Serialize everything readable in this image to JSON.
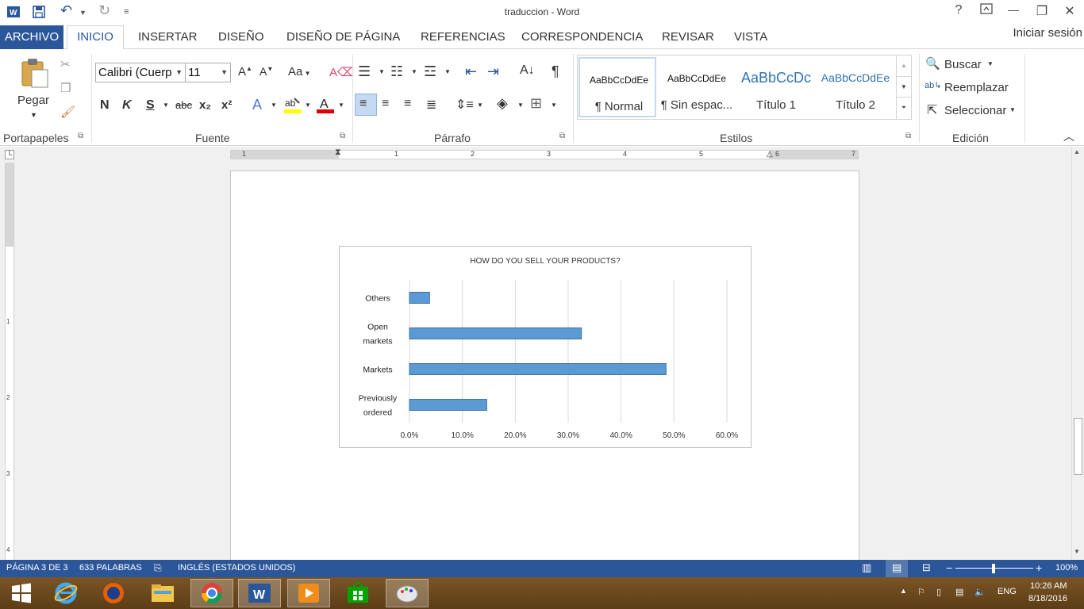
{
  "window": {
    "title": "traduccion - Word",
    "help": "?",
    "minimize": "—",
    "restore": "❐",
    "close": "✕"
  },
  "qat": {
    "undo": "↶",
    "redo": "↻",
    "customize": "≡"
  },
  "tabs": {
    "file": "ARCHIVO",
    "home": "INICIO",
    "items": [
      "INSERTAR",
      "DISEÑO",
      "DISEÑO DE PÁGINA",
      "REFERENCIAS",
      "CORRESPONDENCIA",
      "REVISAR",
      "VISTA"
    ],
    "signin": "Iniciar sesión"
  },
  "ribbon": {
    "clipboard": {
      "paste_label": "Pegar",
      "group": "Portapapeles"
    },
    "font": {
      "name": "Calibri (Cuerp",
      "size": "11",
      "group": "Fuente",
      "bold": "N",
      "italic": "K",
      "underline": "S",
      "strike": "abc",
      "subscript": "x₂",
      "superscript": "x²",
      "case": "Aa"
    },
    "paragraph": {
      "group": "Párrafo",
      "pilcrow": "¶"
    },
    "styles": {
      "group": "Estilos",
      "items": [
        {
          "sample": "AaBbCcDdEe",
          "name": "¶ Normal"
        },
        {
          "sample": "AaBbCcDdEe",
          "name": "¶ Sin espac..."
        },
        {
          "sample": "AaBbCcDc",
          "name": "Título 1"
        },
        {
          "sample": "AaBbCcDdEe",
          "name": "Título 2"
        }
      ]
    },
    "editing": {
      "group": "Edición",
      "find": "Buscar",
      "replace": "Reemplazar",
      "select": "Seleccionar"
    }
  },
  "ruler": {
    "numbers": [
      "1",
      "1",
      "2",
      "3",
      "4",
      "5",
      "6",
      "7"
    ],
    "vnumbers": [
      "1",
      "2",
      "3",
      "4"
    ]
  },
  "chart_data": {
    "type": "bar",
    "orientation": "horizontal",
    "title": "HOW DO YOU SELL YOUR PRODUCTS?",
    "categories": [
      "Others",
      "Open markets",
      "Markets",
      "Previously ordered"
    ],
    "category_lines": [
      [
        "Others"
      ],
      [
        "Open",
        "markets"
      ],
      [
        "Markets"
      ],
      [
        "Previously",
        "ordered"
      ]
    ],
    "values": [
      3.8,
      32.5,
      48.5,
      14.6
    ],
    "xlim": [
      0,
      60
    ],
    "xticks": [
      "0.0%",
      "10.0%",
      "20.0%",
      "30.0%",
      "40.0%",
      "50.0%",
      "60.0%"
    ],
    "bar_color": "#5b9bd5",
    "grid": true
  },
  "status": {
    "page": "PÁGINA 3 DE 3",
    "words": "633 PALABRAS",
    "language": "INGLÉS (ESTADOS UNIDOS)",
    "zoom": "100%"
  },
  "taskbar": {
    "lang": "ENG",
    "time": "10:26 AM",
    "date": "8/18/2016"
  },
  "colors": {
    "accent": "#2b579a",
    "bar": "#5b9bd5",
    "bar_border": "#41719c"
  }
}
